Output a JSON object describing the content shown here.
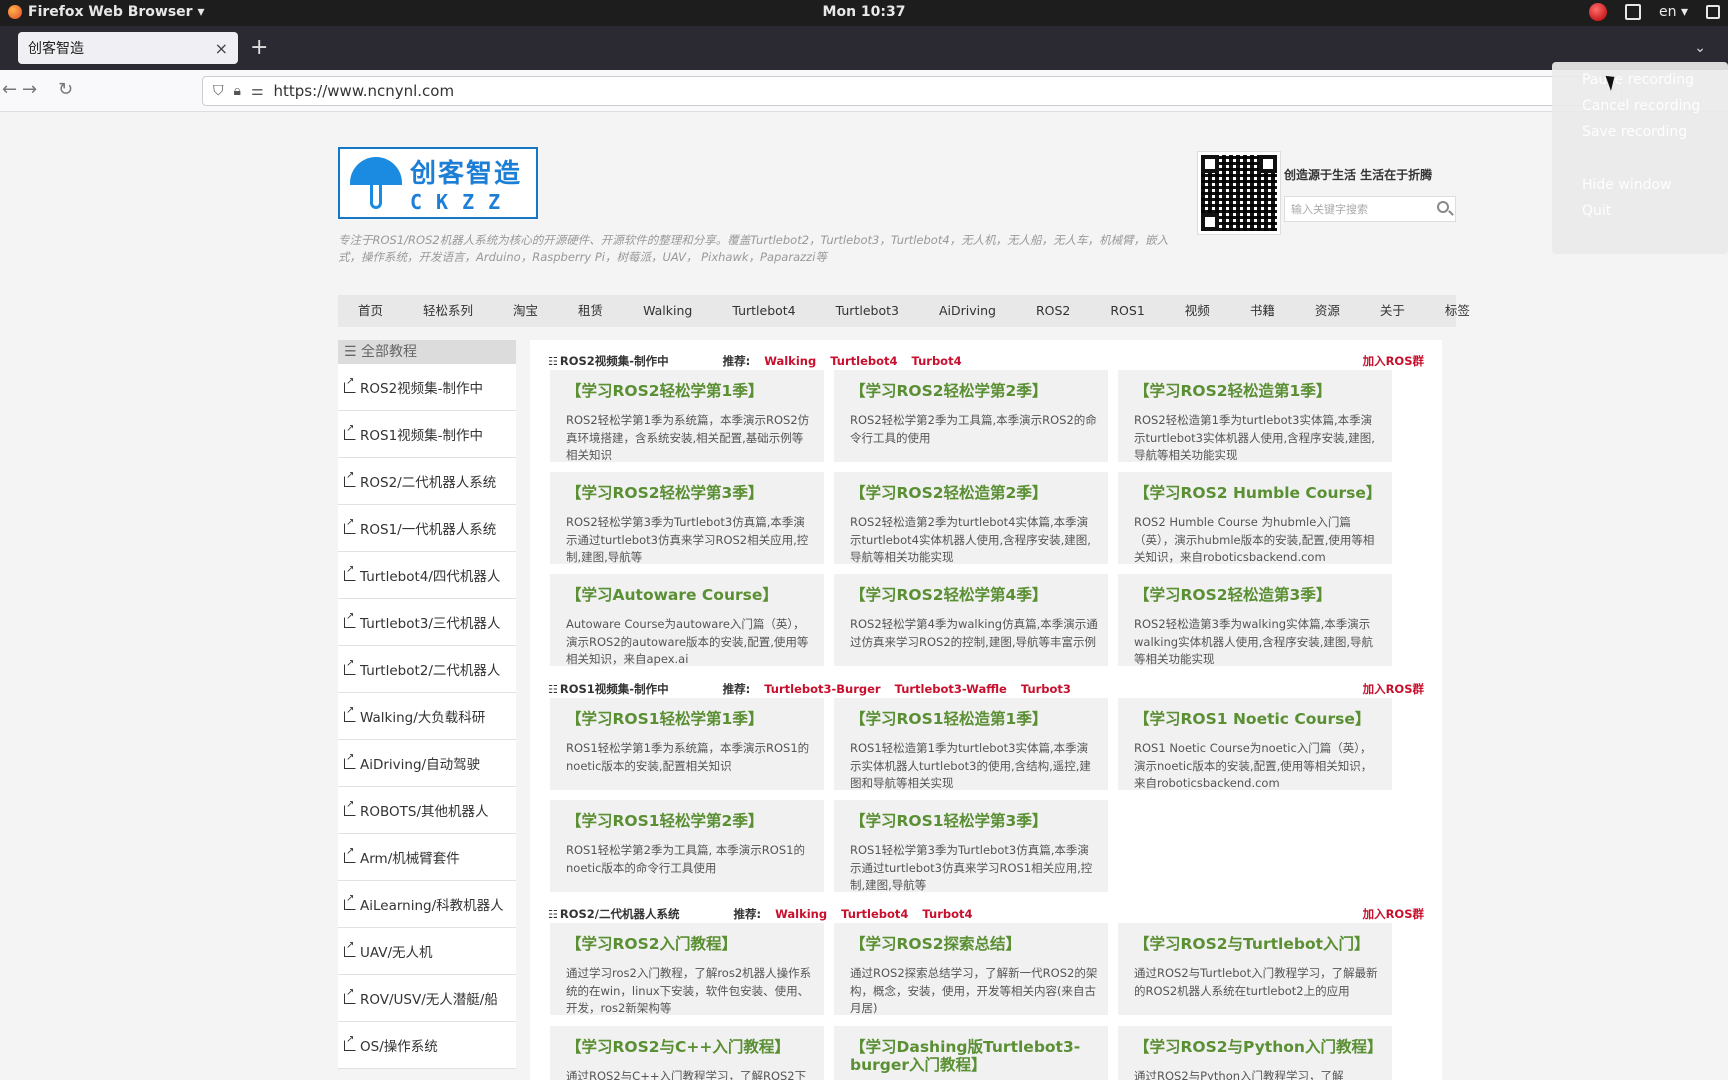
{
  "topbar": {
    "app_menu": "Firefox Web Browser ▾",
    "clock": "Mon 10:37",
    "lang": "en ▾"
  },
  "browser": {
    "tab_title": "创客智造",
    "close_glyph": "×",
    "newtab_glyph": "+",
    "tablist_glyph": "⌄",
    "url": "https://www.ncnynl.com"
  },
  "recmenu": {
    "items": [
      "Pause recording",
      "Cancel recording",
      "Save recording",
      "Hide window",
      "Quit"
    ]
  },
  "site": {
    "logo_cn": "创客智造",
    "logo_en": "CKZZ",
    "tagline": "专注于ROS1/ROS2机器人系统为核心的开源硬件、开源软件的整理和分享。覆盖Turtlebot2，Turtlebot3，Turtlebot4，无人机，无人船，无人车，机械臂，嵌入式，操作系统，开发语言，Arduino，Raspberry Pi，树莓派，UAV， Pixhawk，Paparazzi等",
    "motto": "创造源于生活 生活在于折腾",
    "search_placeholder": "输入关键字搜索",
    "nav": [
      "首页",
      "轻松系列",
      "淘宝",
      "租赁",
      "Walking",
      "Turtlebot4",
      "Turtlebot3",
      "AiDriving",
      "ROS2",
      "ROS1",
      "视频",
      "书籍",
      "资源",
      "关于",
      "标签"
    ]
  },
  "sidebar": {
    "head": "☰ 全部教程",
    "items": [
      "ROS2视频集-制作中",
      "ROS1视频集-制作中",
      "ROS2/二代机器人系统",
      "ROS1/一代机器人系统",
      "Turtlebot4/四代机器人",
      "Turtlebot3/三代机器人",
      "Turtlebot2/二代机器人",
      "Walking/大负载科研",
      "AiDriving/自动驾驶",
      "ROBOTS/其他机器人",
      "Arm/机械臂套件",
      "AiLearning/科教机器人",
      "UAV/无人机",
      "ROV/USV/无人潜艇/船",
      "OS/操作系统"
    ]
  },
  "sections": [
    {
      "title": "ROS2视频集-制作中",
      "rec_label": "推荐:",
      "tags": [
        "Walking",
        "Turtlebot4",
        "Turbot4"
      ],
      "join": "加入ROS群",
      "cards": [
        {
          "title": "【学习ROS2轻松学第1季】",
          "desc": "ROS2轻松学第1季为系统篇，本季演示ROS2仿真环境搭建，含系统安装,相关配置,基础示例等相关知识"
        },
        {
          "title": "【学习ROS2轻松学第2季】",
          "desc": "ROS2轻松学第2季为工具篇,本季演示ROS2的命令行工具的使用"
        },
        {
          "title": "【学习ROS2轻松造第1季】",
          "desc": "ROS2轻松造第1季为turtlebot3实体篇,本季演示turtlebot3实体机器人使用,含程序安装,建图,导航等相关功能实现"
        },
        {
          "title": "【学习ROS2轻松学第3季】",
          "desc": "ROS2轻松学第3季为Turtlebot3仿真篇,本季演示通过turtlebot3仿真来学习ROS2相关应用,控制,建图,导航等"
        },
        {
          "title": "【学习ROS2轻松造第2季】",
          "desc": "ROS2轻松造第2季为turtlebot4实体篇,本季演示turtlebot4实体机器人使用,含程序安装,建图,导航等相关功能实现"
        },
        {
          "title": "【学习ROS2 Humble Course】",
          "desc": "ROS2 Humble Course 为hubmle入门篇（英），演示hubmle版本的安装,配置,使用等相关知识，来自roboticsbackend.com"
        },
        {
          "title": "【学习Autoware Course】",
          "desc": "Autoware Course为autoware入门篇（英），演示ROS2的autoware版本的安装,配置,使用等相关知识，来自apex.ai"
        },
        {
          "title": "【学习ROS2轻松学第4季】",
          "desc": "ROS2轻松学第4季为walking仿真篇,本季演示通过仿真来学习ROS2的控制,建图,导航等丰富示例"
        },
        {
          "title": "【学习ROS2轻松造第3季】",
          "desc": "ROS2轻松造第3季为walking实体篇,本季演示walking实体机器人使用,含程序安装,建图,导航等相关功能实现"
        }
      ]
    },
    {
      "title": "ROS1视频集-制作中",
      "rec_label": "推荐:",
      "tags": [
        "Turtlebot3-Burger",
        "Turtlebot3-Waffle",
        "Turbot3"
      ],
      "join": "加入ROS群",
      "cards": [
        {
          "title": "【学习ROS1轻松学第1季】",
          "desc": "ROS1轻松学第1季为系统篇，本季演示ROS1的noetic版本的安装,配置相关知识"
        },
        {
          "title": "【学习ROS1轻松造第1季】",
          "desc": "ROS1轻松造第1季为turtlebot3实体篇,本季演示实体机器人turtlebot3的使用,含结构,遥控,建图和导航等相关实现"
        },
        {
          "title": "【学习ROS1 Noetic Course】",
          "desc": "ROS1 Noetic Course为noetic入门篇（英），演示noetic版本的安装,配置,使用等相关知识，来自roboticsbackend.com"
        },
        {
          "title": "【学习ROS1轻松学第2季】",
          "desc": "ROS1轻松学第2季为工具篇, 本季演示ROS1的noetic版本的命令行工具使用"
        },
        {
          "title": "【学习ROS1轻松学第3季】",
          "desc": "ROS1轻松学第3季为Turtlebot3仿真篇,本季演示通过turtlebot3仿真来学习ROS1相关应用,控制,建图,导航等"
        }
      ]
    },
    {
      "title": "ROS2/二代机器人系统",
      "rec_label": "推荐:",
      "tags": [
        "Walking",
        "Turtlebot4",
        "Turbot4"
      ],
      "join": "加入ROS群",
      "cards": [
        {
          "title": "【学习ROS2入门教程】",
          "desc": "通过学习ros2入门教程，了解ros2机器人操作系统的在win，linux下安装，软件包安装、使用、开发，ros2新架构等"
        },
        {
          "title": "【学习ROS2探索总结】",
          "desc": "通过ROS2探索总结学习，了解新一代ROS2的架构，概念，安装，使用，开发等相关内容(来自古月居)"
        },
        {
          "title": "【学习ROS2与Turtlebot入门】",
          "desc": "通过ROS2与Turtlebot入门教程学习，了解最新的ROS2机器人系统在turtlebot2上的应用"
        },
        {
          "title": "【学习ROS2与C++入门教程】",
          "desc": "通过ROS2与C++入门教程学习，了解ROS2下"
        },
        {
          "title": "【学习Dashing版Turtlebot3-burger入门教程】",
          "desc": ""
        },
        {
          "title": "【学习ROS2与Python入门教程】",
          "desc": "通过ROS2与Python入门教程学习，了解"
        }
      ]
    }
  ]
}
